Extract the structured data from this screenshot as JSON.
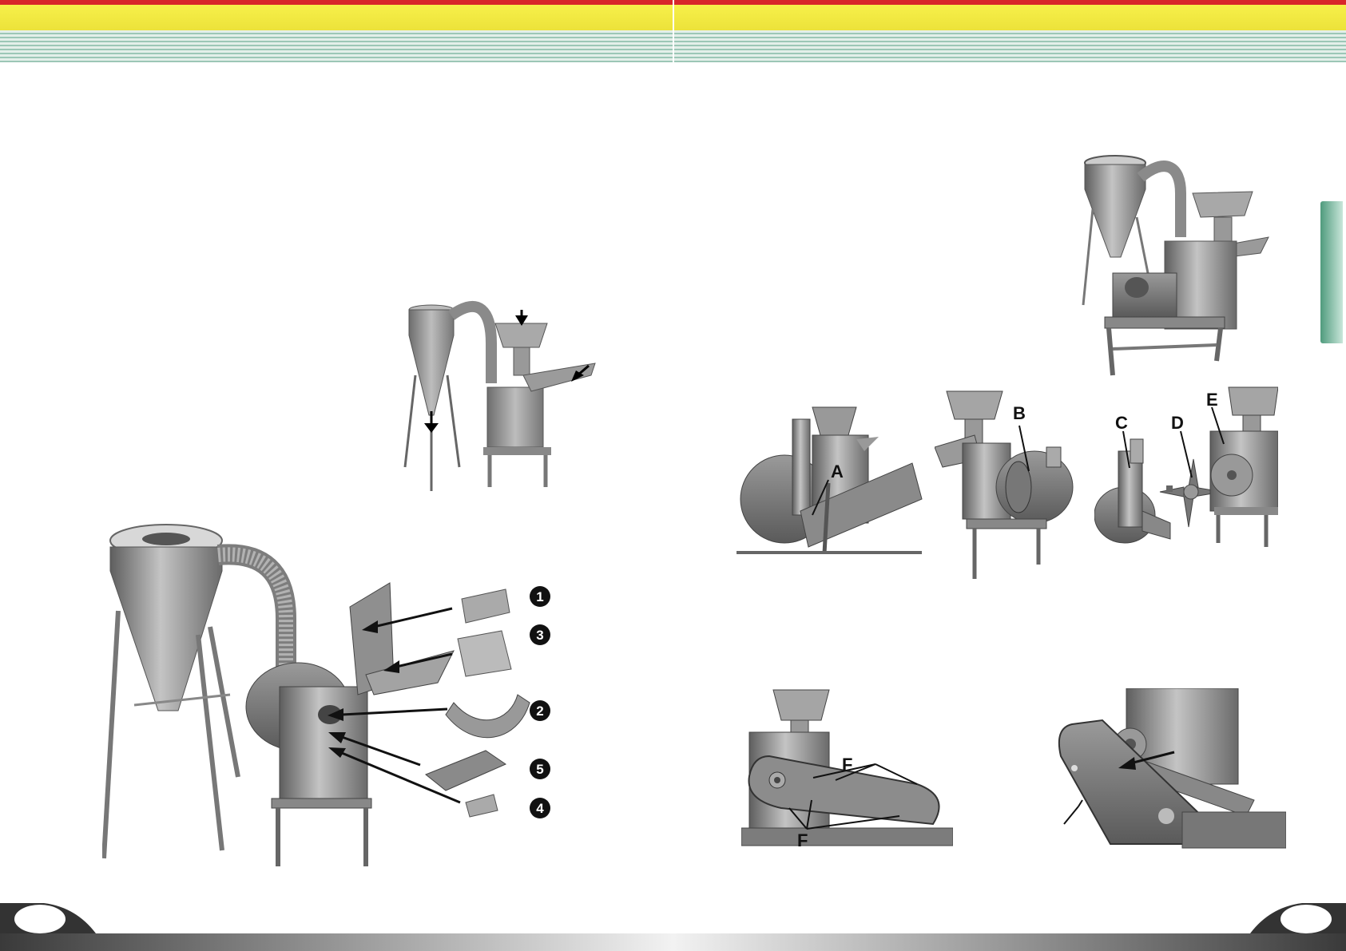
{
  "callouts": {
    "n1": "1",
    "n2": "2",
    "n3": "3",
    "n4": "4",
    "n5": "5",
    "a": "A",
    "b": "B",
    "c": "C",
    "d": "D",
    "e": "E",
    "f1": "F",
    "f2": "F"
  }
}
